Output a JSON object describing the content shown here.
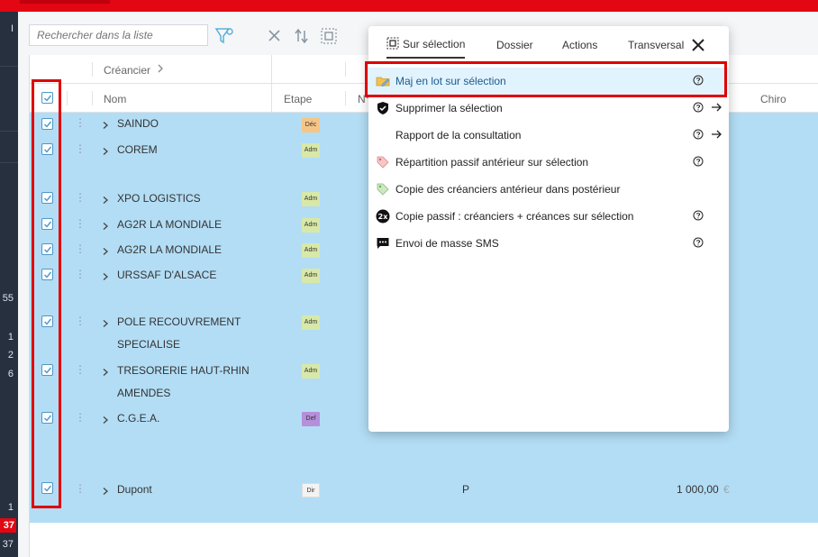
{
  "leftnav": {
    "items": [
      {
        "label": "I"
      },
      {
        "label": "55"
      },
      {
        "label": "1"
      },
      {
        "label": "2"
      },
      {
        "label": "6"
      },
      {
        "label": "1"
      }
    ],
    "badge": "37",
    "bottom": "37"
  },
  "toolbar": {
    "search_placeholder": "Rechercher dans la liste",
    "icons": [
      "filter-icon",
      "clear-icon",
      "sort-icon",
      "select-icon"
    ]
  },
  "grid": {
    "group_header": "Créancier",
    "columns": {
      "name": "Nom",
      "etape": "Etape",
      "num": "N°",
      "chiro": "Chiro"
    },
    "rows": [
      {
        "name": "SAINDO",
        "etape": "Déc"
      },
      {
        "name": "COREM",
        "etape": "Adm"
      },
      {
        "name": "XPO LOGISTICS",
        "etape": "Adm"
      },
      {
        "name": "AG2R LA MONDIALE",
        "etape": "Adm"
      },
      {
        "name": "AG2R LA MONDIALE",
        "etape": "Adm"
      },
      {
        "name": "URSSAF D'ALSACE",
        "etape": "Adm"
      },
      {
        "name": "POLE RECOUVREMENT",
        "name2": "SPECIALISE",
        "etape": "Adm"
      },
      {
        "name": "TRESORERIE HAUT-RHIN",
        "name2": "AMENDES",
        "etape": "Adm"
      },
      {
        "name": "C.G.E.A.",
        "etape": "Def"
      },
      {
        "name": "Dupont",
        "etape": "Dir",
        "col": "P",
        "amount": "1 000,00",
        "currency": "€"
      }
    ]
  },
  "menu": {
    "tabs": [
      "Sur sélection",
      "Dossier",
      "Actions",
      "Transversal"
    ],
    "active_tab": "Sur sélection",
    "items": [
      {
        "label": "Maj en lot sur sélection",
        "icon": "folder-edit-icon",
        "help": true,
        "arrow": false
      },
      {
        "label": "Supprimer la sélection",
        "icon": "shield-icon",
        "help": true,
        "arrow": true
      },
      {
        "label": "Rapport de la consultation",
        "icon": "",
        "help": true,
        "arrow": true
      },
      {
        "label": "Répartition passif antérieur sur sélection",
        "icon": "tag-icon",
        "help": true,
        "arrow": false
      },
      {
        "label": "Copie des créanciers antérieur dans postérieur",
        "icon": "tag-icon",
        "help": false,
        "arrow": false
      },
      {
        "label": "Copie passif : créanciers + créances sur sélection",
        "icon": "double-icon",
        "help": true,
        "arrow": false
      },
      {
        "label": "Envoi de masse SMS",
        "icon": "sms-icon",
        "help": true,
        "arrow": false
      }
    ],
    "double_icon_text": "2x"
  },
  "colors": {
    "brand_red": "#e30613",
    "nav_bg": "#26303f",
    "row_selected": "#b3ddf5",
    "highlight": "#e1f3fd"
  }
}
